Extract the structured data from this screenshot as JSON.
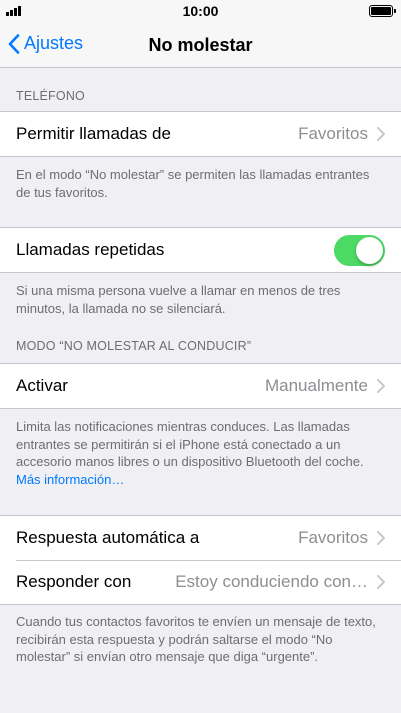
{
  "status_bar": {
    "time": "10:00"
  },
  "nav": {
    "back_label": "Ajustes",
    "title": "No molestar"
  },
  "telefono": {
    "header": "TELÉFONO",
    "permitir": {
      "label": "Permitir llamadas de",
      "value": "Favoritos"
    },
    "permitir_footer": "En el modo “No molestar” se permiten las llamadas entrantes de tus favoritos.",
    "repetidas": {
      "label": "Llamadas repetidas",
      "toggle_on": true
    },
    "repetidas_footer": "Si una misma persona vuelve a llamar en menos de tres minutos, la llamada no se silenciará."
  },
  "conducir": {
    "header": "MODO “NO MOLESTAR AL CONDUCIR”",
    "activar": {
      "label": "Activar",
      "value": "Manualmente"
    },
    "activar_footer": "Limita las notificaciones mientras conduces. Las llamadas entrantes se permitirán si el iPhone está conectado a un accesorio manos libres o un dispositivo Bluetooth del coche.",
    "mas_info": "Más información…",
    "respuesta": {
      "label": "Respuesta automática a",
      "value": "Favoritos"
    },
    "responder": {
      "label": "Responder con",
      "value": "Estoy conduciendo con…"
    },
    "responder_footer": "Cuando tus contactos favoritos te envíen un mensaje de texto, recibirán esta respuesta y podrán saltarse el modo “No molestar” si envían otro mensaje que diga “urgente”."
  },
  "colors": {
    "accent": "#007aff",
    "toggle_on": "#4cd964",
    "background": "#efeff4"
  }
}
